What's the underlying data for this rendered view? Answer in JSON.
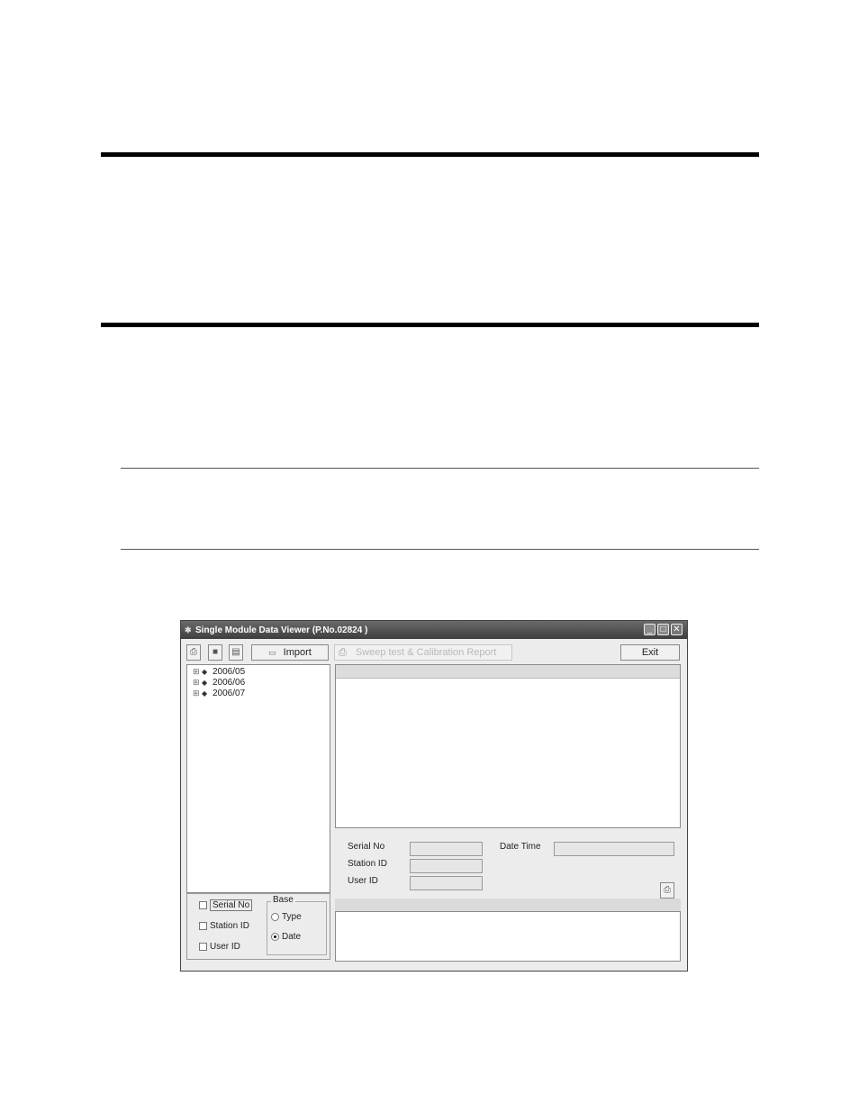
{
  "window": {
    "title": "Single Module Data Viewer (P.No.02824 )",
    "controls": {
      "minimize": "_",
      "maximize": "□",
      "close": "✕"
    }
  },
  "toolbar": {
    "print_icon": "printer-icon",
    "save_icon": "save-icon",
    "copy_icon": "clipboard-icon",
    "import_label": "Import",
    "report_label": "Sweep test & Calibration Report",
    "exit_label": "Exit"
  },
  "tree": {
    "items": [
      {
        "label": "2006/05"
      },
      {
        "label": "2006/06"
      },
      {
        "label": "2006/07"
      }
    ]
  },
  "details": {
    "serial_no_label": "Serial No",
    "station_id_label": "Station ID",
    "user_id_label": "User ID",
    "date_time_label": "Date Time"
  },
  "filters": {
    "serial_no": "Serial No",
    "station_id": "Station ID",
    "user_id": "User ID"
  },
  "base": {
    "title": "Base",
    "type_label": "Type",
    "date_label": "Date",
    "selected": "Date"
  },
  "colors": {
    "titlebar": "#4f4f4f",
    "window_bg": "#ececec"
  }
}
